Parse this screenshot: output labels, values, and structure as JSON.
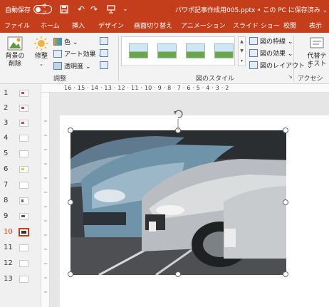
{
  "titlebar": {
    "autosave_label": "自動保存",
    "autosave_state": "オフ",
    "title": "パワポ記事作成用005.pptx • この PC に保存済み ⌄",
    "icons": [
      "save-icon",
      "undo-icon",
      "redo-icon",
      "present-icon"
    ]
  },
  "tabs": [
    {
      "label": "ファイル"
    },
    {
      "label": "ホーム"
    },
    {
      "label": "挿入"
    },
    {
      "label": "デザイン"
    },
    {
      "label": "画面切り替え"
    },
    {
      "label": "アニメーション"
    },
    {
      "label": "スライド ショー"
    },
    {
      "label": "校閲"
    },
    {
      "label": "表示"
    }
  ],
  "ribbon": {
    "remove_bg": "背景の\n削除",
    "corrections": "修整",
    "color": "色 ⌄",
    "artistic": "アート効果 ⌄",
    "transparency": "透明度 ⌄",
    "adjust_group": "調整",
    "styles_group": "図のスタイル",
    "border": "図の枠線 ⌄",
    "effects": "図の効果 ⌄",
    "layout": "図のレイアウト ⌄",
    "alt_text": "代替テ\nキスト",
    "access_group": "アクセシビ"
  },
  "slides": [
    {
      "num": "1"
    },
    {
      "num": "2"
    },
    {
      "num": "3"
    },
    {
      "num": "4"
    },
    {
      "num": "5"
    },
    {
      "num": "6"
    },
    {
      "num": "7"
    },
    {
      "num": "8"
    },
    {
      "num": "9"
    },
    {
      "num": "10"
    },
    {
      "num": "11"
    },
    {
      "num": "12"
    },
    {
      "num": "13"
    }
  ],
  "active_slide": "10",
  "ruler": "16 · 15 · 14 · 13 · 12 · 11 · 10 · 9 · 8 · 7 · 6 · 5 · 4 · 3 · 2",
  "colors": {
    "accent": "#c43e1c",
    "ribbon": "#f3f3f3"
  }
}
